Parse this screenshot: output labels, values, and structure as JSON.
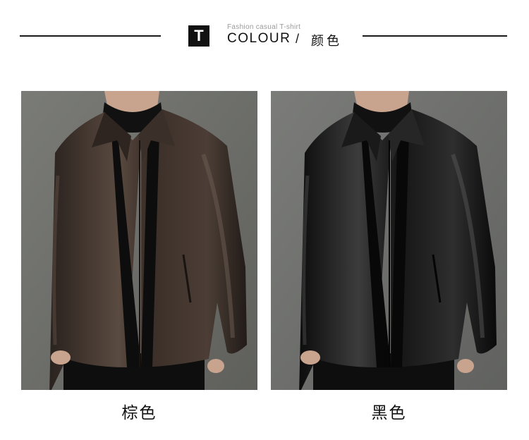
{
  "header": {
    "badge_letter": "T",
    "subtitle": "Fashion casual T-shirt",
    "title": "COLOUR",
    "separator": "/",
    "title_cn": "颜色"
  },
  "products": [
    {
      "caption": "棕色",
      "jacket_color": "#3a2e28",
      "highlight_color": "#6a5a50",
      "background_color": "#6f706c",
      "icon": "brown-leather-jacket"
    },
    {
      "caption": "黑色",
      "jacket_color": "#141414",
      "highlight_color": "#4a4a4a",
      "background_color": "#707170",
      "icon": "black-leather-jacket"
    }
  ]
}
